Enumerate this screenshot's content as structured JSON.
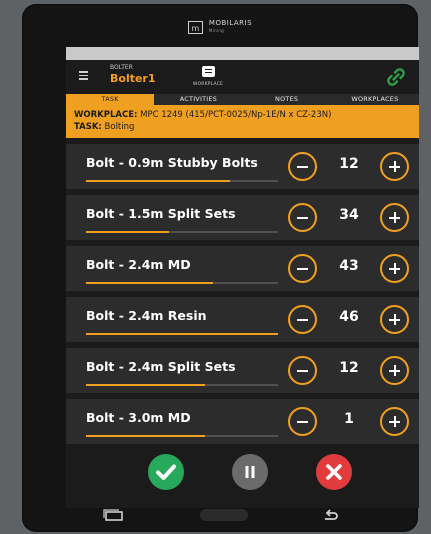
{
  "device": {
    "brand_name": "MOBILARIS",
    "brand_tagline": "Mining"
  },
  "app": {
    "role": "BOLTER",
    "user_name": "Bolter1",
    "workplace_button_label": "WORKPLACE",
    "connection_status_color": "#2e9e46"
  },
  "tabs": [
    {
      "label": "TASK",
      "active": true
    },
    {
      "label": "ACTIVITIES",
      "active": false
    },
    {
      "label": "NOTES",
      "active": false
    },
    {
      "label": "WORKPLACES",
      "active": false
    }
  ],
  "info": {
    "workplace_label": "WORKPLACE:",
    "workplace_value": "MPC 1249 (415/PCT-0025/Np-1E/N x CZ-23N)",
    "task_label": "TASK:",
    "task_value": "Bolting"
  },
  "bolts": [
    {
      "label": "Bolt - 0.9m Stubby Bolts",
      "qty": "12",
      "progress": 0.75
    },
    {
      "label": "Bolt - 1.5m Split Sets",
      "qty": "34",
      "progress": 0.43
    },
    {
      "label": "Bolt - 2.4m MD",
      "qty": "43",
      "progress": 0.66
    },
    {
      "label": "Bolt - 2.4m Resin",
      "qty": "46",
      "progress": 1.0
    },
    {
      "label": "Bolt - 2.4m Split Sets",
      "qty": "12",
      "progress": 0.62
    },
    {
      "label": "Bolt - 3.0m MD",
      "qty": "1",
      "progress": 0.62
    }
  ],
  "colors": {
    "accent": "#f0a020",
    "confirm": "#27a85a",
    "pause": "#6b6b6b",
    "cancel": "#e23b3b"
  },
  "icons": {
    "confirm": "checkmark-icon",
    "pause": "pause-icon",
    "cancel": "x-icon"
  }
}
